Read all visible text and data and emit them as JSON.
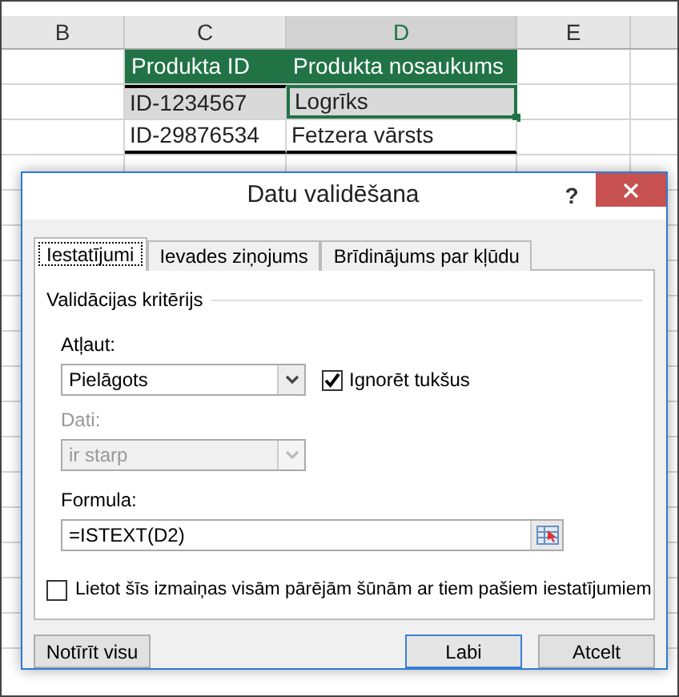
{
  "sheet": {
    "columns": [
      {
        "label": "B",
        "selected": false
      },
      {
        "label": "C",
        "selected": false
      },
      {
        "label": "D",
        "selected": true
      },
      {
        "label": "E",
        "selected": false
      }
    ],
    "table": {
      "headers": [
        "Produkta ID",
        "Produkta nosaukums"
      ],
      "rows": [
        {
          "cells": [
            {
              "text": "ID-1234567",
              "selected": true,
              "active": false
            },
            {
              "text": "Logrīks",
              "selected": true,
              "active": true
            }
          ]
        },
        {
          "cells": [
            {
              "text": "ID-29876534",
              "selected": false,
              "active": false
            },
            {
              "text": "Fetzera vārsts",
              "selected": false,
              "active": false
            }
          ]
        }
      ]
    }
  },
  "dialog": {
    "title": "Datu validēšana",
    "help": "?",
    "tabs": [
      {
        "label": "Iestatījumi",
        "selected": true
      },
      {
        "label": "Ievades ziņojums",
        "selected": false
      },
      {
        "label": "Brīdinājums par kļūdu",
        "selected": false
      }
    ],
    "group_title": "Validācijas kritērijs",
    "allow": {
      "label": "Atļaut:",
      "value": "Pielāgots",
      "disabled": false
    },
    "ignore_blank": {
      "label": "Ignorēt tukšus",
      "checked": true
    },
    "data": {
      "label": "Dati:",
      "value": "ir starp",
      "disabled": true
    },
    "formula": {
      "label": "Formula:",
      "value": "=ISTEXT(D2)"
    },
    "apply_all": {
      "label": "Lietot šīs izmaiņas visām pārējām šūnām ar tiem pašiem iestatījumiem",
      "checked": false
    },
    "buttons": [
      {
        "label": "Notīrīt visu",
        "default": false
      },
      {
        "label": "Labi",
        "default": true
      },
      {
        "label": "Atcelt",
        "default": false
      }
    ]
  }
}
